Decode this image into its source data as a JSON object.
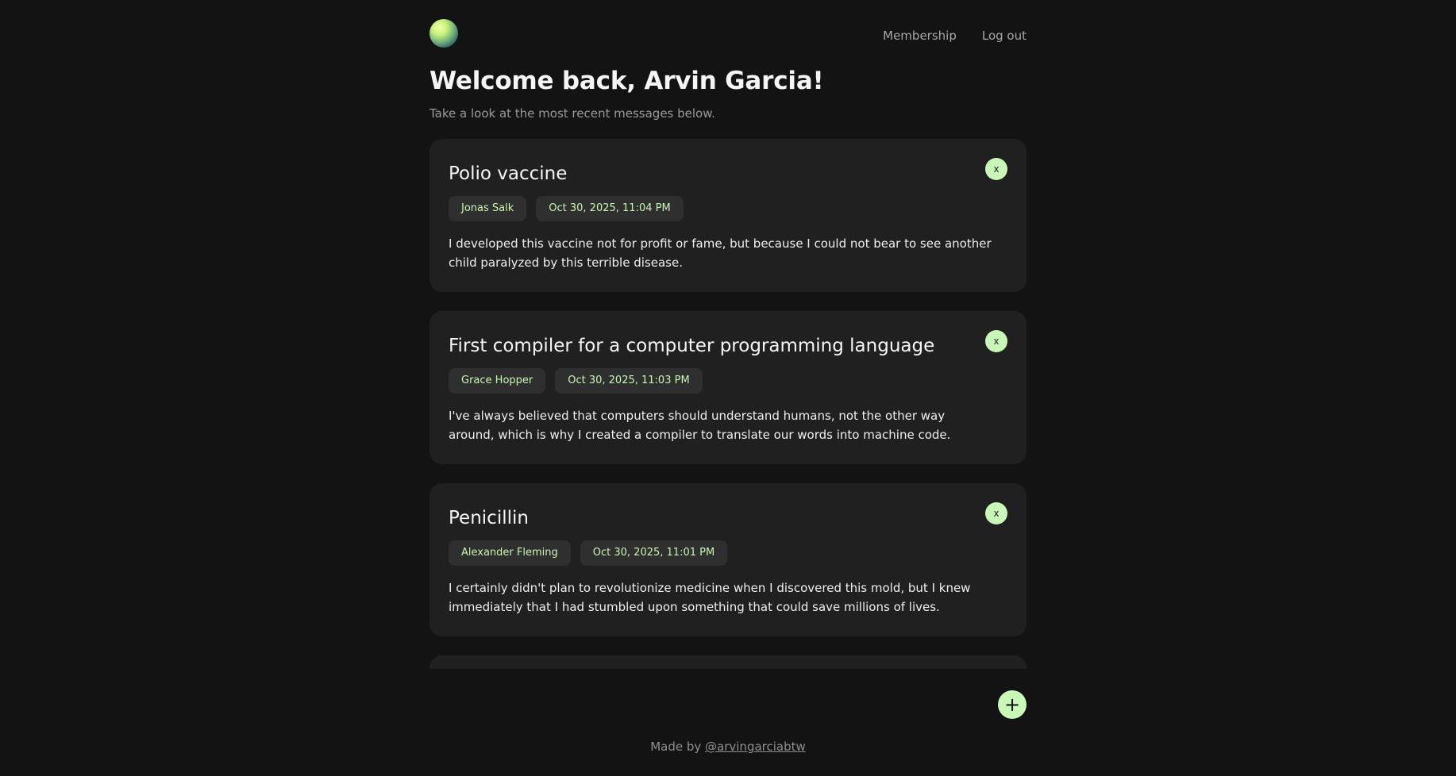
{
  "nav": {
    "membership": "Membership",
    "logout": "Log out"
  },
  "header": {
    "title": "Welcome back, Arvin Garcia!",
    "subtitle": "Take a look at the most recent messages below."
  },
  "messages": [
    {
      "title": "Polio vaccine",
      "author": "Jonas Salk",
      "date": "Oct 30, 2025, 11:04 PM",
      "body": "I developed this vaccine not for profit or fame, but because I could not bear to see another child paralyzed by this terrible disease.",
      "close": "x"
    },
    {
      "title": "First compiler for a computer programming language",
      "author": "Grace Hopper",
      "date": "Oct 30, 2025, 11:03 PM",
      "body": "I've always believed that computers should understand humans, not the other way around, which is why I created a compiler to translate our words into machine code.",
      "close": "x"
    },
    {
      "title": "Penicillin",
      "author": "Alexander Fleming",
      "date": "Oct 30, 2025, 11:01 PM",
      "body": "I certainly didn't plan to revolutionize medicine when I discovered this mold, but I knew immediately that I had stumbled upon something that could save millions of lives.",
      "close": "x"
    }
  ],
  "add_button": "+",
  "footer": {
    "prefix": "Made by ",
    "link": "@arvingarciabtw"
  },
  "colors": {
    "background": "#131313",
    "card": "#202020",
    "accent": "#c8f7b8"
  }
}
